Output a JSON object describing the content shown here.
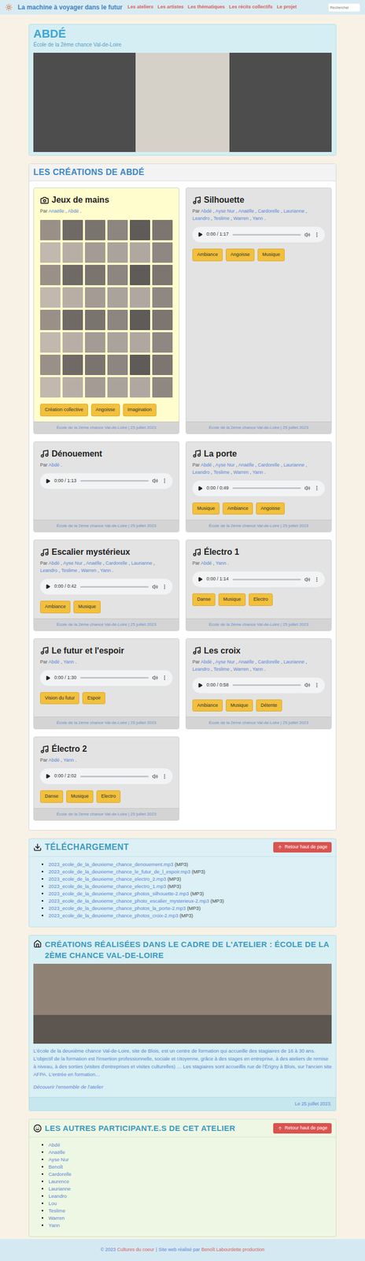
{
  "nav": {
    "logo": "La machine à voyager dans le futur",
    "links": [
      "Les ateliers",
      "Les artistes",
      "Les thématiques",
      "Les récits collectifs",
      "Le projet"
    ],
    "search_placeholder": "Rechercher"
  },
  "header": {
    "title": "ABDÉ",
    "subtitle": "École de la 2ème chance Val-de-Loire"
  },
  "creations": {
    "title": "LES CRÉATIONS DE ABDÉ",
    "byline_prefix": "Par",
    "author_separator": ",",
    "byline_end": ".",
    "cards": [
      {
        "kind": "photos",
        "title": "Jeux de mains",
        "authors": [
          "Anaëlle",
          "Abdé"
        ],
        "tags": [
          "Création collective",
          "Angoisse",
          "Imagination"
        ],
        "footer": "École de la 2ème chance Val-de-Loire | 25 juillet 2023"
      },
      {
        "kind": "audio",
        "title": "Silhouette",
        "authors": [
          "Abdé",
          "Ayse Nur",
          "Anaëlle",
          "Cardorelle",
          "Laurianne",
          "Leandro",
          "Teslime",
          "Warren",
          "Yann"
        ],
        "time": "0:00 / 1:17",
        "tags": [
          "Ambiance",
          "Angoisse",
          "Musique"
        ],
        "footer": "École de la 2ème chance Val-de-Loire | 25 juillet 2023"
      },
      {
        "kind": "audio",
        "title": "Dénouement",
        "authors": [
          "Abdé"
        ],
        "time": "0:00 / 1:13",
        "tags": [],
        "footer": "École de la 2ème chance Val-de-Loire | 25 juillet 2023"
      },
      {
        "kind": "audio",
        "title": "La porte",
        "authors": [
          "Abdé",
          "Ayse Nur",
          "Anaëlle",
          "Cardorelle",
          "Laurianne",
          "Leandro",
          "Teslime",
          "Warren",
          "Yann"
        ],
        "time": "0:00 / 0:49",
        "tags": [
          "Musique",
          "Ambiance",
          "Angoisse"
        ],
        "footer": "École de la 2ème chance Val-de-Loire | 25 juillet 2023"
      },
      {
        "kind": "audio",
        "title": "Escalier mystérieux",
        "authors": [
          "Abdé",
          "Ayse Nur",
          "Anaëlle",
          "Cardorelle",
          "Laurianne",
          "Leandro",
          "Teslime",
          "Warren",
          "Yann"
        ],
        "time": "0:00 / 0:42",
        "tags": [
          "Ambiance",
          "Musique"
        ],
        "footer": "École de la 2ème chance Val-de-Loire | 25 juillet 2023"
      },
      {
        "kind": "audio",
        "title": "Électro 1",
        "authors": [
          "Abdé",
          "Yann"
        ],
        "time": "0:00 / 1:14",
        "tags": [
          "Danse",
          "Musique",
          "Electro"
        ],
        "footer": "École de la 2ème chance Val-de-Loire | 25 juillet 2023"
      },
      {
        "kind": "audio",
        "title": "Le futur et l'espoir",
        "authors": [
          "Abdé",
          "Yann"
        ],
        "time": "0:00 / 1:30",
        "tags": [
          "Vision du futur",
          "Espoir"
        ],
        "footer": "École de la 2ème chance Val-de-Loire | 25 juillet 2023"
      },
      {
        "kind": "audio",
        "title": "Les croix",
        "authors": [
          "Abdé",
          "Ayse Nur",
          "Anaëlle",
          "Cardorelle",
          "Laurianne",
          "Leandro",
          "Teslime",
          "Warren",
          "Yann"
        ],
        "time": "0:00 / 0:58",
        "tags": [
          "Ambiance",
          "Musique",
          "Détente"
        ],
        "footer": "École de la 2ème chance Val-de-Loire | 25 juillet 2023"
      },
      {
        "kind": "audio",
        "title": "Électro 2",
        "authors": [
          "Abdé",
          "Yann"
        ],
        "time": "0:00 / 2:02",
        "tags": [
          "Danse",
          "Musique",
          "Electro"
        ],
        "footer": "École de la 2ème chance Val-de-Loire | 25 juillet 2023"
      }
    ]
  },
  "download": {
    "title": "TÉLÉCHARGEMENT",
    "back_button": "Retour haut de page",
    "files": [
      {
        "name": "2023_ecole_de_la_deuxieme_chance_denouement.mp3",
        "format": "(MP3)"
      },
      {
        "name": "2023_ecole_de_la_deuxieme_chance_le_futur_de_l_espoir.mp3",
        "format": "(MP3)"
      },
      {
        "name": "2023_ecole_de_la_deuxieme_chance_electro_2.mp3",
        "format": "(MP3)"
      },
      {
        "name": "2023_ecole_de_la_deuxieme_chance_electro_1.mp3",
        "format": "(MP3)"
      },
      {
        "name": "2023_ecole_de_la_deuxieme_chance_photos_silhouette-2.mp3",
        "format": "(MP3)"
      },
      {
        "name": "2023_ecole_de_la_deuxieme_chance_photo_escalier_mysterieux-2.mp3",
        "format": "(MP3)"
      },
      {
        "name": "2023_ecole_de_la_deuxieme_chance_photos_la_porte-2.mp3",
        "format": "(MP3)"
      },
      {
        "name": "2023_ecole_de_la_deuxieme_chance_photos_croix-2.mp3",
        "format": "(MP3)"
      }
    ]
  },
  "atelier": {
    "title": "CRÉATIONS RÉALISÉES DANS LE CADRE DE L'ATELIER : ÉCOLE DE LA 2ÈME CHANCE VAL-DE-LOIRE",
    "description": "L'école de la deuxième chance Val-de-Loire, site de Blois, est un centre de formation qui accueille des stagiaires de 16 à 30 ans. L'objectif de la formation est l'insertion professionnelle, sociale et citoyenne, grâce à des stages en entreprise, à des ateliers de remise à niveau, à des sorties (visites d'entreprises et visites culturelles) … Les stagiaires sont accueillis rue de l'Érigny à Blois, sur l'ancien site AFPA. L'entrée en formation…",
    "link": "Découvrir l'ensemble de l'atelier",
    "date": "Le 25 juillet 2023."
  },
  "participants": {
    "title": "LES AUTRES PARTICIPANT.E.S DE CET ATELIER",
    "back_button": "Retour haut de page",
    "names": [
      "Abdé",
      "Anaëlle",
      "Ayse Nur",
      "Benoît",
      "Cardorelle",
      "Laurence",
      "Laurianne",
      "Leandro",
      "Lou",
      "Teslime",
      "Warren",
      "Yann"
    ]
  },
  "footer": {
    "copyright": "© 2023",
    "org": "Cultures du coeur",
    "separator": "|",
    "made_by": "Site web réalisé par",
    "author": "Benoît Labourdette production"
  }
}
